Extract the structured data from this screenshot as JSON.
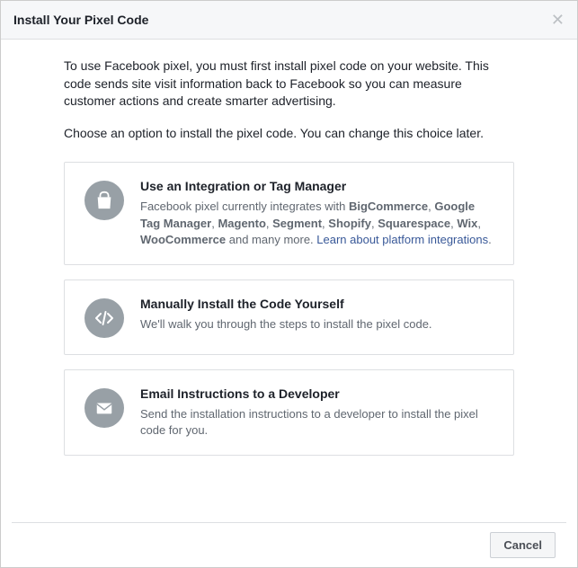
{
  "header": {
    "title": "Install Your Pixel Code"
  },
  "intro": "To use Facebook pixel, you must first install pixel code on your website. This code sends site visit information back to Facebook so you can measure customer actions and create smarter advertising.",
  "subintro": "Choose an option to install the pixel code. You can change this choice later.",
  "options": {
    "integration": {
      "title": "Use an Integration or Tag Manager",
      "desc_prefix": "Facebook pixel currently integrates with ",
      "bold1": "BigCommerce",
      "sep1": ", ",
      "bold2": "Google Tag Manager",
      "sep2": ", ",
      "bold3": "Magento",
      "sep3": ", ",
      "bold4": "Segment",
      "sep4": ", ",
      "bold5": "Shopify",
      "sep5": ", ",
      "bold6": "Squarespace",
      "sep6": ", ",
      "bold7": "Wix",
      "sep7": ", ",
      "bold8": "WooCommerce",
      "desc_suffix": " and many more. ",
      "link": "Learn about platform integrations",
      "period": "."
    },
    "manual": {
      "title": "Manually Install the Code Yourself",
      "desc": "We'll walk you through the steps to install the pixel code."
    },
    "email": {
      "title": "Email Instructions to a Developer",
      "desc": "Send the installation instructions to a developer to install the pixel code for you."
    }
  },
  "footer": {
    "cancel": "Cancel"
  }
}
